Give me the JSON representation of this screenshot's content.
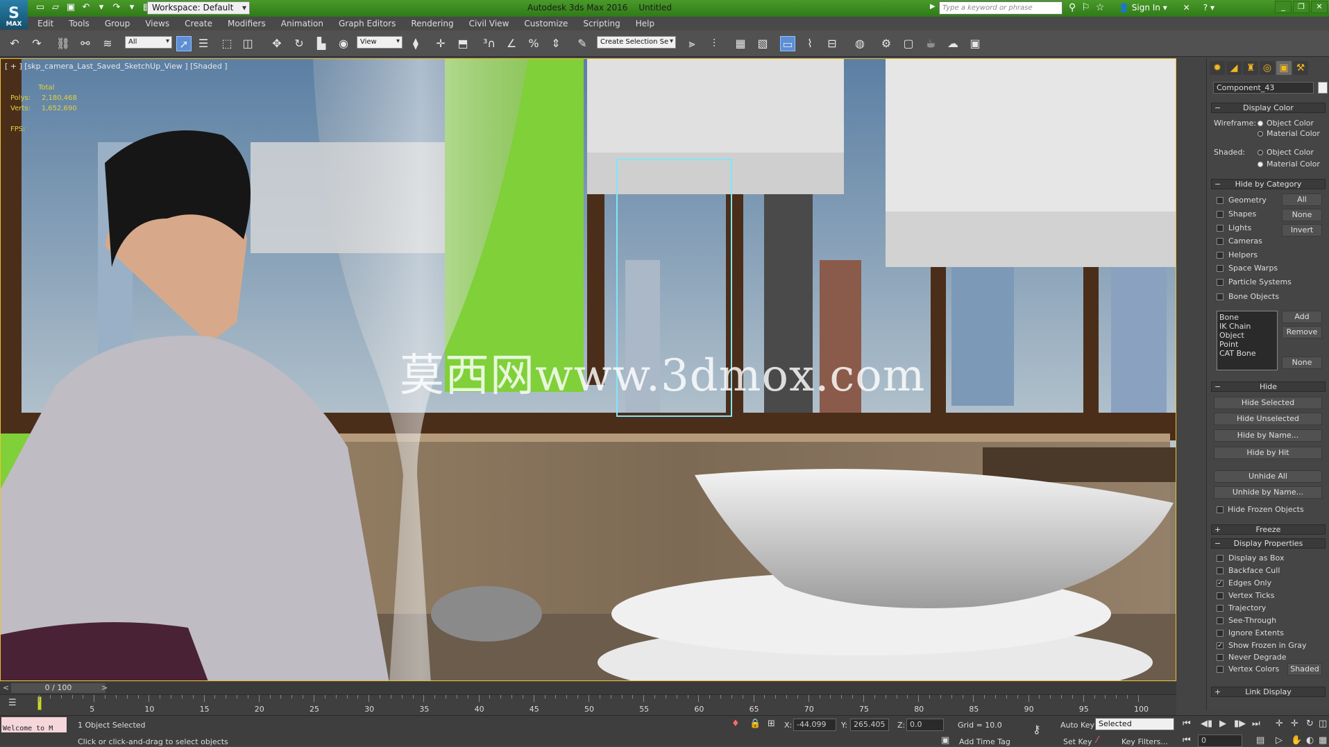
{
  "app": {
    "logo_label": "MAX",
    "workspace": "Workspace: Default",
    "title": "Autodesk 3ds Max 2016",
    "document": "Untitled",
    "search_placeholder": "Type a keyword or phrase",
    "sign_in": "Sign In"
  },
  "menu": [
    "Edit",
    "Tools",
    "Group",
    "Views",
    "Create",
    "Modifiers",
    "Animation",
    "Graph Editors",
    "Rendering",
    "Civil View",
    "Customize",
    "Scripting",
    "Help"
  ],
  "toolbar": {
    "selection_filter": "All",
    "ref_coord": "View",
    "named_selection": "Create Selection Se"
  },
  "viewport": {
    "label": "[ + ] [skp_camera_Last_Saved_SketchUp_View ] [Shaded ]",
    "stats_header": "Total",
    "polys_label": "Polys:",
    "polys_value": "2,180,468",
    "verts_label": "Verts:",
    "verts_value": "1,652,690",
    "fps_label": "FPS:",
    "watermark": "莫西网www.3dmox.com"
  },
  "panel": {
    "object_name": "Component_43",
    "display_color": {
      "title": "Display Color",
      "wireframe_label": "Wireframe:",
      "shaded_label": "Shaded:",
      "object_color": "Object Color",
      "material_color": "Material Color"
    },
    "hide_by_category": {
      "title": "Hide by Category",
      "items": [
        "Geometry",
        "Shapes",
        "Lights",
        "Cameras",
        "Helpers",
        "Space Warps",
        "Particle Systems",
        "Bone Objects"
      ],
      "all": "All",
      "none": "None",
      "invert": "Invert",
      "list": [
        "Bone",
        "IK Chain Object",
        "Point",
        "CAT Bone"
      ],
      "add": "Add",
      "remove": "Remove",
      "none2": "None"
    },
    "hide": {
      "title": "Hide",
      "buttons": [
        "Hide Selected",
        "Hide Unselected",
        "Hide by Name...",
        "Hide by Hit",
        "Unhide All",
        "Unhide by Name..."
      ],
      "frozen": "Hide Frozen Objects"
    },
    "freeze_title": "Freeze",
    "display_properties": {
      "title": "Display Properties",
      "items": [
        "Display as Box",
        "Backface Cull",
        "Edges Only",
        "Vertex Ticks",
        "Trajectory",
        "See-Through",
        "Ignore Extents",
        "Show Frozen in Gray",
        "Never Degrade",
        "Vertex Colors"
      ],
      "checked": [
        false,
        false,
        true,
        false,
        false,
        false,
        false,
        true,
        false,
        false
      ],
      "shaded_button": "Shaded"
    },
    "link_display_title": "Link Display"
  },
  "timeline": {
    "frame": "0 / 100",
    "ticks": [
      "5",
      "10",
      "15",
      "20",
      "25",
      "30",
      "35",
      "40",
      "45",
      "50",
      "55",
      "60",
      "65",
      "70",
      "75",
      "80",
      "85",
      "90",
      "95",
      "100"
    ]
  },
  "status": {
    "welcome": "Welcome to M",
    "selected": "1 Object Selected",
    "prompt": "Click or click-and-drag to select objects",
    "x_label": "X:",
    "x_value": "-44.099",
    "y_label": "Y:",
    "y_value": "265.405",
    "z_label": "Z:",
    "z_value": "0.0",
    "grid": "Grid = 10.0",
    "add_time_tag": "Add Time Tag",
    "auto_key": "Auto Key",
    "set_key": "Set Key",
    "key_mode": "Selected",
    "key_filters": "Key Filters...",
    "frame_field": "0"
  }
}
